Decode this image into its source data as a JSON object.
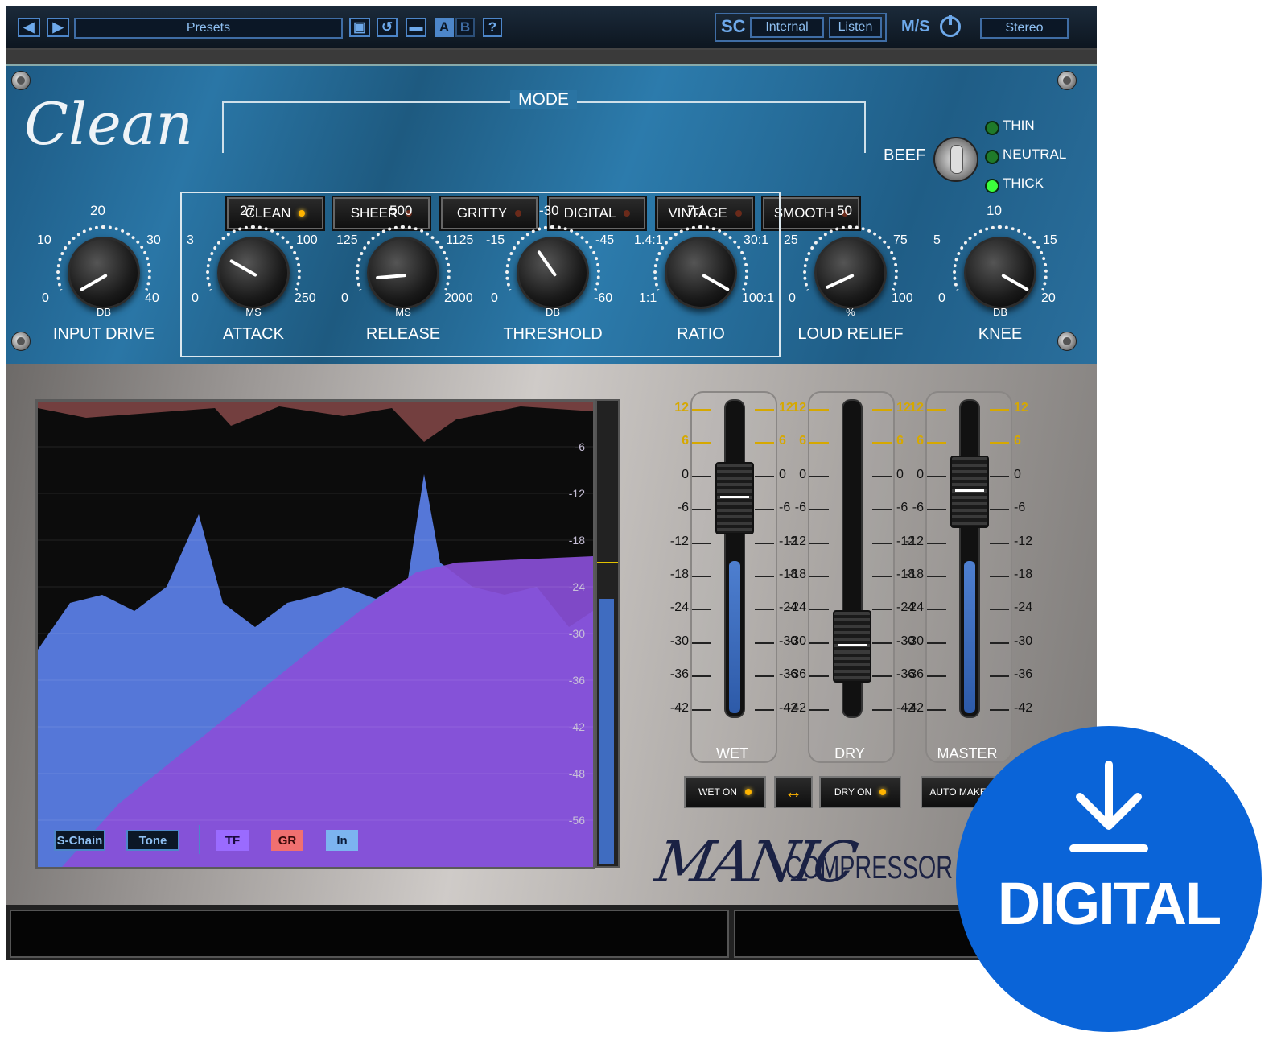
{
  "topbar": {
    "presets_label": "Presets",
    "ab_a": "A",
    "ab_b": "B",
    "help": "?",
    "sc_label": "SC",
    "sc_source": "Internal",
    "listen": "Listen",
    "ms_label": "M/S",
    "stereo": "Stereo"
  },
  "header": {
    "preset_script": "Clean",
    "mode_title": "MODE",
    "modes": [
      "CLEAN",
      "SHEER",
      "GRITTY",
      "DIGITAL",
      "VINTAGE",
      "SMOOTH"
    ],
    "active_mode": "CLEAN",
    "beef_label": "BEEF",
    "beef_options": [
      "THIN",
      "NEUTRAL",
      "THICK"
    ]
  },
  "knobs": [
    {
      "name": "INPUT DRIVE",
      "unit": "DB",
      "top": "20",
      "left_hi": "10",
      "right_hi": "30",
      "left_lo": "0",
      "right_lo": "40",
      "angle": -120
    },
    {
      "name": "ATTACK",
      "unit": "MS",
      "top": "27",
      "left_hi": "3",
      "right_hi": "100",
      "left_lo": "0",
      "right_lo": "250",
      "angle": -60
    },
    {
      "name": "RELEASE",
      "unit": "MS",
      "top": "500",
      "left_hi": "125",
      "right_hi": "1125",
      "left_lo": "0",
      "right_lo": "2000",
      "angle": -95
    },
    {
      "name": "THRESHOLD",
      "unit": "DB",
      "top": "-30",
      "left_hi": "-15",
      "right_hi": "-45",
      "left_lo": "0",
      "right_lo": "-60",
      "angle": -35
    },
    {
      "name": "RATIO",
      "unit": "",
      "top": "7:1",
      "left_hi": "1.4:1",
      "right_hi": "30:1",
      "left_lo": "1:1",
      "right_lo": "100:1",
      "angle": 120
    },
    {
      "name": "LOUD RELIEF",
      "unit": "%",
      "top": "50",
      "left_hi": "25",
      "right_hi": "75",
      "left_lo": "0",
      "right_lo": "100",
      "angle": -115
    },
    {
      "name": "KNEE",
      "unit": "DB",
      "top": "10",
      "left_hi": "5",
      "right_hi": "15",
      "left_lo": "0",
      "right_lo": "20",
      "angle": 120
    }
  ],
  "analyzer": {
    "db_scale": [
      "-6",
      "-12",
      "-18",
      "-24",
      "-30",
      "-36",
      "-42",
      "-48",
      "-56"
    ],
    "buttons": [
      "S-Chain",
      "Tone",
      "TF",
      "GR",
      "In"
    ]
  },
  "faders": {
    "scale": [
      "12",
      "6",
      "0",
      "-6",
      "-12",
      "-18",
      "-24",
      "-30",
      "-36",
      "-42"
    ],
    "channels": [
      {
        "name": "WET",
        "level": 0.82,
        "cap_pos": 0.25
      },
      {
        "name": "DRY",
        "level": 0.0,
        "cap_pos": 0.72
      },
      {
        "name": "MASTER",
        "level": 0.82,
        "cap_pos": 0.23
      }
    ],
    "buttons": [
      "WET ON",
      "DRY ON",
      "AUTO MAKEUP"
    ],
    "swap": "↔"
  },
  "brand": {
    "manic": "MANIC",
    "compressor": "COMPRESSOR"
  },
  "badge": {
    "label": "DIGITAL"
  }
}
